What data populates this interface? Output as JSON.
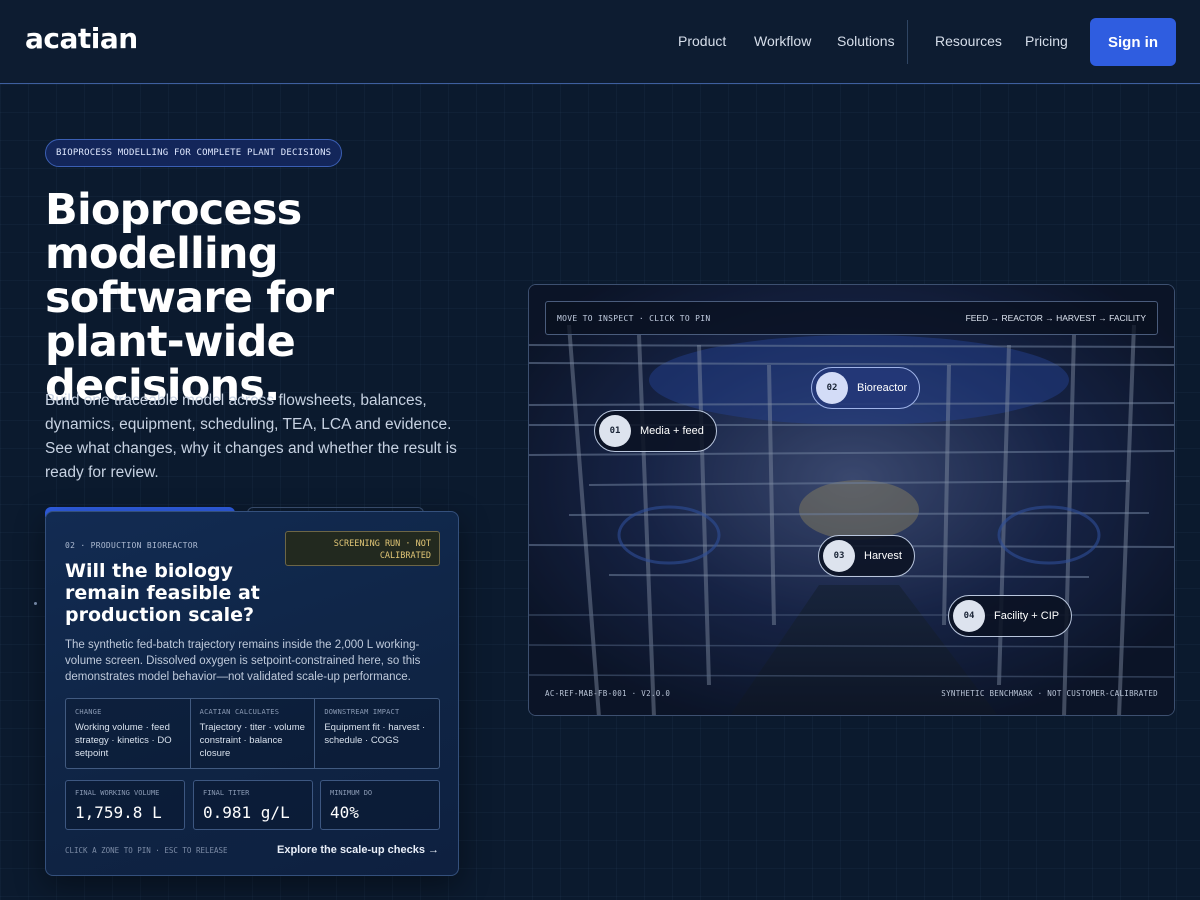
{
  "brand": {
    "logo": "acatian"
  },
  "nav": {
    "items": [
      "Product",
      "Workflow",
      "Solutions",
      "Resources",
      "Pricing"
    ],
    "signin_label": "Sign in",
    "signin_color": "#2f5de0"
  },
  "hero": {
    "eyebrow": "BIOPROCESS MODELLING FOR COMPLETE PLANT DECISIONS",
    "title": "Bioprocess modelling software for plant-wide decisions.",
    "subtitle": "Build one traceable model across flowsheets, balances, dynamics, equipment, scheduling, TEA, LCA and evidence. See what changes, why it changes and whether the result is ready for review."
  },
  "scenario": {
    "label": "02 · PRODUCTION BIOREACTOR",
    "status": "SCREENING RUN · NOT CALIBRATED",
    "title": "Will the biology remain feasible at production scale?",
    "description": "The synthetic fed-batch trajectory remains inside the 2,000 L working-volume screen. Dissolved oxygen is setpoint-constrained here, so this demonstrates model behavior—not validated scale-up performance.",
    "impact": [
      {
        "heading": "CHANGE",
        "body": "Working volume · feed strategy · kinetics · DO setpoint"
      },
      {
        "heading": "ACATIAN CALCULATES",
        "body": "Trajectory · titer · volume constraint · balance closure"
      },
      {
        "heading": "DOWNSTREAM IMPACT",
        "body": "Equipment fit · harvest · schedule · COGS"
      }
    ],
    "metrics": [
      {
        "label": "FINAL WORKING VOLUME",
        "value": "1,759.8 L"
      },
      {
        "label": "FINAL TITER",
        "value": "0.981 g/L"
      },
      {
        "label": "MINIMUM DO",
        "value": "40%"
      }
    ],
    "hint": "CLICK A ZONE TO PIN · ESC TO RELEASE",
    "link": "Explore the scale-up checks →"
  },
  "viewer": {
    "top_left": "MOVE TO INSPECT · CLICK TO PIN",
    "top_right": "FEED → REACTOR → HARVEST → FACILITY",
    "footer_left": "AC-REF-MAB-FB-001 · V2.0.0",
    "footer_right": "SYNTHETIC BENCHMARK · NOT CUSTOMER-CALIBRATED",
    "hotspots": [
      {
        "num": "01",
        "label": "Media + feed"
      },
      {
        "num": "02",
        "label": "Bioreactor"
      },
      {
        "num": "03",
        "label": "Harvest"
      },
      {
        "num": "04",
        "label": "Facility + CIP"
      }
    ]
  }
}
